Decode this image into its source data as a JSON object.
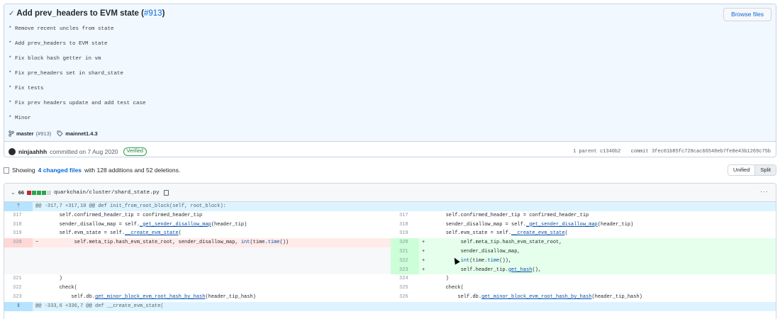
{
  "commit": {
    "title_text": "Add prev_headers to EVM state (",
    "pr_link": "#913",
    "title_close": ")",
    "browse_files": "Browse files",
    "description": [
      "* Remove recent uncles from state",
      "* Add prev_headers to EVM state",
      "* Fix block hash getter in vm",
      "* Fix pre_headers set in shard_state",
      "* Fix tests",
      "* Fix prev headers update and add test case",
      "* Minor"
    ],
    "branch": "master",
    "branch_pr": "(#913)",
    "tag": "mainnet1.4.3",
    "author": "ninjaahhh",
    "committed_text": "committed on 7 Aug 2020",
    "verified": "Verified",
    "parent_label": "1 parent",
    "parent_sha": "c1340b2",
    "commit_label": "commit",
    "commit_sha": "3fec01b85fc728cac66548eb7fe8e43b1269c75b"
  },
  "summary": {
    "prefix": "Showing",
    "files_link": "4 changed files",
    "middle": "with 128 additions and 52 deletions.",
    "unified": "Unified",
    "split": "Split"
  },
  "file": {
    "count": "66",
    "path": "quarkchain/cluster/shard_state.py",
    "more": "···"
  },
  "diff": {
    "hunk1": "@@ -317,7 +317,10 @@ def init_from_root_block(self, root_block):",
    "hunk2": "@@ -333,6 +336,7 @@ def __create_evm_state(",
    "left_317": "317",
    "left_318": "318",
    "left_319": "319",
    "left_320": "320",
    "left_321": "321",
    "left_322": "322",
    "left_323": "323",
    "right_317": "317",
    "right_318": "318",
    "right_319": "319",
    "right_320": "320",
    "right_321": "321",
    "right_322": "322",
    "right_323": "323",
    "right_324": "324",
    "right_325": "325",
    "right_326": "326",
    "code_317": "        self.confirmed_header_tip = confirmed_header_tip",
    "code_318a": "        sender_disallow_map = self.",
    "code_318b": "_get_sender_disallow_map",
    "code_318c": "(header_tip)",
    "code_319a": "        self.evm_state = self.",
    "code_319b": "__create_evm_state",
    "code_319c": "(",
    "del_320a": "            self.meta_tip.hash_evm_state_root, sender_disallow_map, ",
    "del_320b": "int",
    "del_320c": "(time.",
    "del_320d": "time",
    "del_320e": "())",
    "add_320": "            self.meta_tip.hash_evm_state_root,",
    "add_321": "            sender_disallow_map,",
    "add_322a": "            ",
    "add_322b": "int",
    "add_322c": "(time.",
    "add_322d": "time",
    "add_322e": "()),",
    "add_323a": "            self.header_tip.",
    "add_323b": "get_hash",
    "add_323c": "(),",
    "code_close": "        )",
    "code_check": "        check(",
    "code_db_a": "            self.db.",
    "code_db_b": "get_minor_block_evm_root_hash_by_hash",
    "code_db_c": "(header_tip_hash)",
    "minus": "−",
    "plus": "+"
  },
  "colors": {
    "link": "#0969da",
    "add": "#2da44e",
    "del": "#cf222e"
  }
}
